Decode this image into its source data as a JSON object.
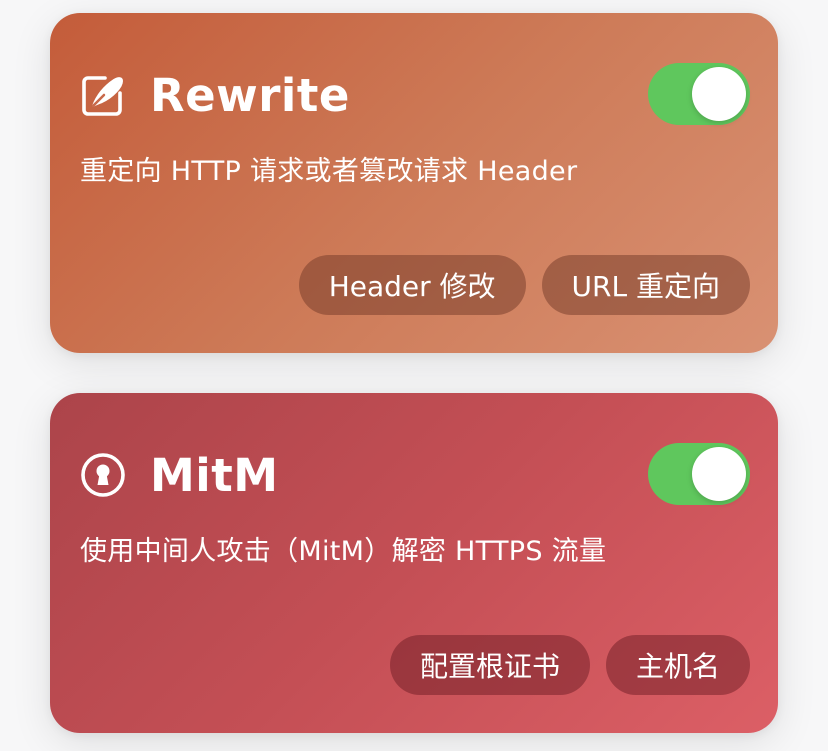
{
  "cards": [
    {
      "id": "rewrite",
      "icon": "edit-icon",
      "title": "Rewrite",
      "description": "重定向 HTTP 请求或者篡改请求 Header",
      "enabled": true,
      "actions": [
        {
          "label": "Header 修改"
        },
        {
          "label": "URL 重定向"
        }
      ]
    },
    {
      "id": "mitm",
      "icon": "keyhole-icon",
      "title": "MitM",
      "description": "使用中间人攻击（MitM）解密 HTTPS 流量",
      "enabled": true,
      "actions": [
        {
          "label": "配置根证书"
        },
        {
          "label": "主机名"
        }
      ]
    }
  ],
  "colors": {
    "toggle_on": "#5fc75d",
    "rewrite_gradient_start": "#c45c3a",
    "rewrite_gradient_end": "#d99173",
    "mitm_gradient_start": "#ac444a",
    "mitm_gradient_end": "#dc5f66"
  }
}
